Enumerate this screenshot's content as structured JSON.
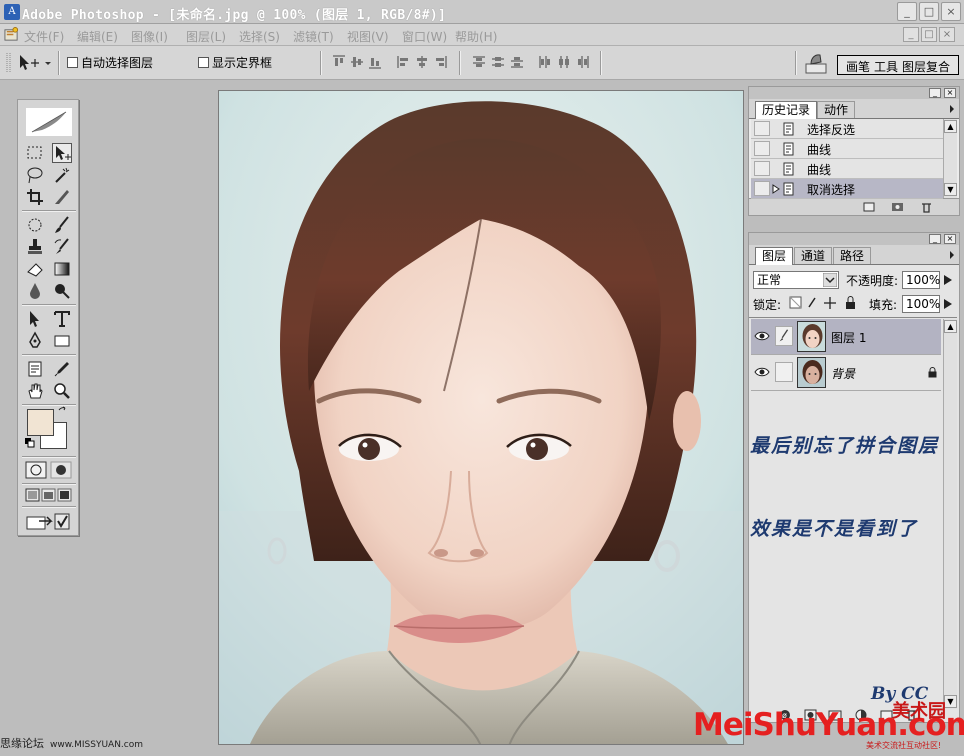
{
  "window": {
    "title": "Adobe Photoshop - [未命名.jpg @ 100% (图层 1, RGB/8#)]",
    "min_label": "_",
    "max_label": "□",
    "close_label": "×"
  },
  "menu": {
    "items": [
      "文件(F)",
      "编辑(E)",
      "图像(I)",
      "图层(L)",
      "选择(S)",
      "滤镜(T)",
      "视图(V)",
      "窗口(W)",
      "帮助(H)"
    ]
  },
  "options": {
    "auto_select_label": "自动选择图层",
    "show_bounds_label": "显示定界框",
    "palette_well": [
      "画笔",
      "工具",
      "图层复合"
    ]
  },
  "colors": {
    "foreground": "#f1e4d3",
    "background": "#ffffff",
    "accent_annotation": "#1e3a70",
    "brand_red": "#e52020"
  },
  "history": {
    "tabs": [
      "历史记录",
      "动作"
    ],
    "items": [
      {
        "label": "选择反选",
        "selected": false
      },
      {
        "label": "曲线",
        "selected": false
      },
      {
        "label": "曲线",
        "selected": false
      },
      {
        "label": "取消选择",
        "selected": true
      }
    ]
  },
  "layers": {
    "tabs": [
      "图层",
      "通道",
      "路径"
    ],
    "blend_mode": "正常",
    "opacity_label": "不透明度:",
    "opacity_value": "100%",
    "lock_label": "锁定:",
    "fill_label": "填充:",
    "fill_value": "100%",
    "items": [
      {
        "name": "图层 1",
        "selected": true,
        "locked": false
      },
      {
        "name": "背景",
        "selected": false,
        "locked": true
      }
    ]
  },
  "annotations": {
    "line1": "最后别忘了拼合图层",
    "line2": "效果是不是看到了",
    "byline": "By  CC"
  },
  "watermarks": {
    "forum": "思缘论坛",
    "forum_url": "www.MISSYUAN.com",
    "brand": "MeiShuYuan.com",
    "brand_cn": "美术园",
    "brand_sub": "美术交流社互动社区!"
  },
  "icons": [
    "move-icon",
    "marquee-icon",
    "lasso-icon",
    "magic-wand-icon",
    "crop-icon",
    "slice-icon",
    "healing-brush-icon",
    "brush-icon",
    "stamp-icon",
    "history-brush-icon",
    "eraser-icon",
    "gradient-icon",
    "blur-icon",
    "dodge-icon",
    "path-select-icon",
    "type-icon",
    "pen-icon",
    "shape-icon",
    "notes-icon",
    "eyedropper-icon",
    "hand-icon",
    "zoom-icon",
    "eye-icon",
    "lock-icon",
    "brush-palette-icon"
  ]
}
